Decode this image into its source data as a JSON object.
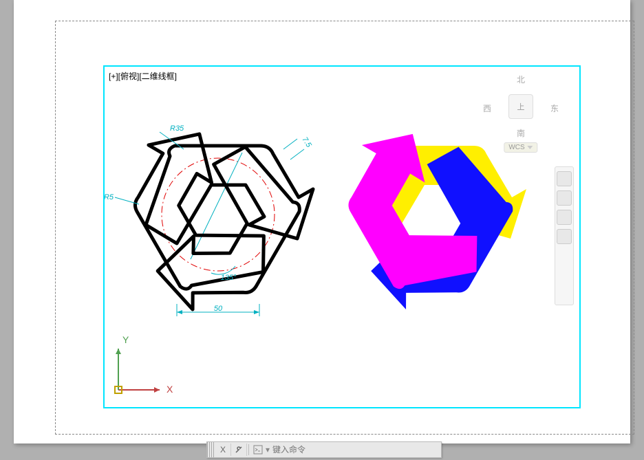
{
  "viewport_label": "[+][俯视][二维线框]",
  "viewcube": {
    "north": "北",
    "south": "南",
    "west": "西",
    "east": "东",
    "top": "上",
    "wcs": "WCS"
  },
  "ucs": {
    "x_label": "X",
    "y_label": "Y"
  },
  "dimensions": {
    "r35": "R35",
    "r5": "R5",
    "d7_5": "7.5",
    "ang135": "135°",
    "len50": "50"
  },
  "command_bar": {
    "close": "X",
    "placeholder": "键入命令"
  },
  "colors": {
    "viewport_border": "#00E5FF",
    "construction_circle": "#E00000",
    "dim": "#00B0C0",
    "arrow_yellow": "#FFEF00",
    "arrow_blue": "#1010FF",
    "arrow_magenta": "#FF00FF",
    "ucs_x": "#C04040",
    "ucs_y": "#50A050",
    "ucs_origin": "#C0A000"
  },
  "chart_data": {
    "type": "diagram",
    "description": "CAD drawing of a three-arrow recycling symbol. Left instance is black outline with construction circle and dimensions; right instance has three arrows filled yellow, blue and magenta.",
    "construction_circle_radius": 82,
    "dimensions_visible": [
      "R35",
      "R5",
      "7.5",
      "135°",
      "50"
    ],
    "arrows": [
      {
        "position": "top",
        "fill": "#FFEF00"
      },
      {
        "position": "left",
        "fill": "#1010FF"
      },
      {
        "position": "right",
        "fill": "#FF00FF"
      }
    ]
  }
}
